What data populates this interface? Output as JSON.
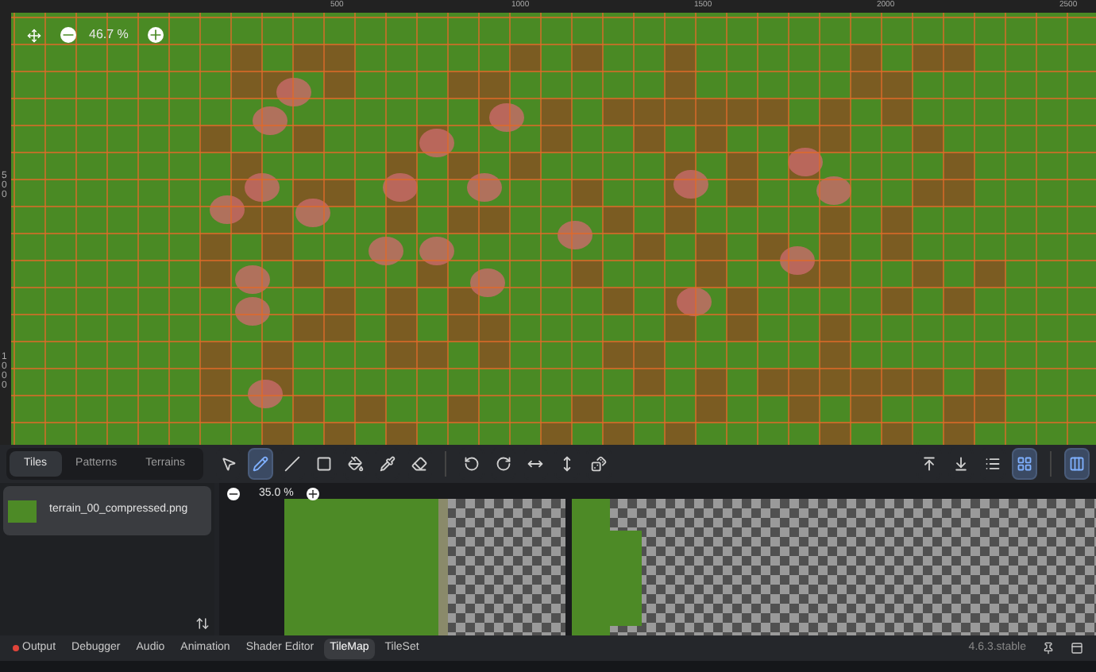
{
  "ruler": {
    "top_labels": [
      "500",
      "1000",
      "1500",
      "2000",
      "2500"
    ],
    "left_labels": [
      "500",
      "1000"
    ]
  },
  "viewport": {
    "zoom": "46.7 %"
  },
  "tile_panel": {
    "tabs": [
      {
        "label": "Tiles",
        "selected": true
      },
      {
        "label": "Patterns",
        "selected": false
      },
      {
        "label": "Terrains",
        "selected": false
      }
    ],
    "tools": [
      {
        "kind": "select",
        "selected": false
      },
      {
        "kind": "paint",
        "selected": true
      },
      {
        "kind": "line",
        "selected": false
      },
      {
        "kind": "rect",
        "selected": false
      },
      {
        "kind": "bucket",
        "selected": false
      },
      {
        "kind": "picker",
        "selected": false
      },
      {
        "kind": "eraser",
        "selected": false
      },
      {
        "kind": "sep"
      },
      {
        "kind": "rotate_left",
        "selected": false
      },
      {
        "kind": "rotate_right",
        "selected": false
      },
      {
        "kind": "flip_h",
        "selected": false
      },
      {
        "kind": "flip_v",
        "selected": false
      },
      {
        "kind": "random",
        "selected": false
      }
    ],
    "right_tools": [
      {
        "kind": "move_up",
        "selected": false
      },
      {
        "kind": "move_down",
        "selected": false
      },
      {
        "kind": "list",
        "selected": false
      },
      {
        "kind": "grid",
        "selected": true
      },
      {
        "kind": "sep"
      },
      {
        "kind": "layout",
        "selected": true
      }
    ],
    "sources": [
      {
        "name": "terrain_00_compressed.png",
        "selected": true
      }
    ],
    "atlas_zoom": "35.0 %"
  },
  "bottom_tabs": [
    {
      "label": "Output",
      "selected": false,
      "color": "#e0443a"
    },
    {
      "label": "Debugger",
      "selected": false
    },
    {
      "label": "Audio",
      "selected": false
    },
    {
      "label": "Animation",
      "selected": false
    },
    {
      "label": "Shader Editor",
      "selected": false
    },
    {
      "label": "TileMap",
      "selected": true
    },
    {
      "label": "TileSet",
      "selected": false
    }
  ],
  "version": "4.6.3.stable"
}
